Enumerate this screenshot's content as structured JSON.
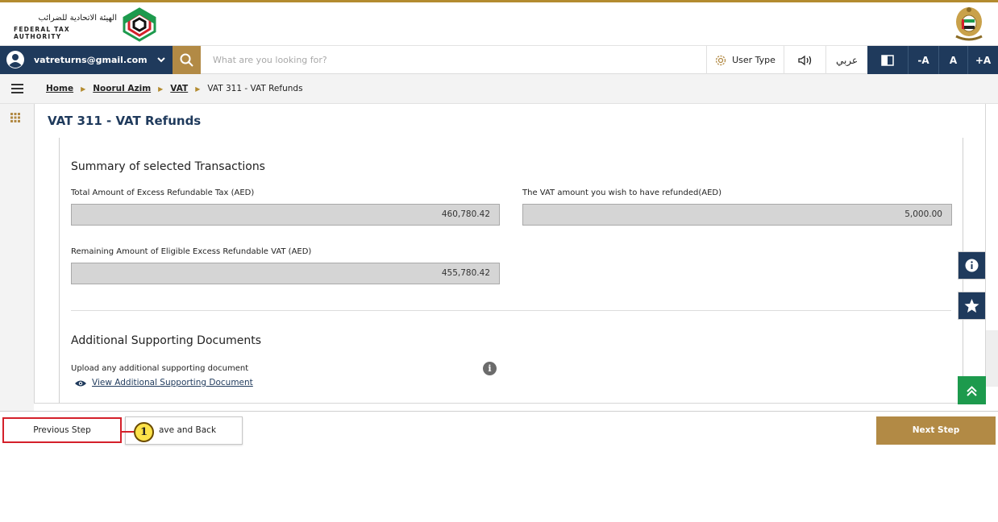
{
  "header": {
    "logo_arabic": "الهيئة الاتحادية للضرائب",
    "logo_english": "FEDERAL TAX AUTHORITY",
    "logo_icon": "fta-logo-icon",
    "emblem_icon": "uae-emblem-icon"
  },
  "toolbar": {
    "user_email": "vatreturns@gmail.com",
    "search_placeholder": "What are you looking for?",
    "user_type_label": "User Type",
    "arabic_label": "عربي",
    "font_decrease": "-A",
    "font_normal": "A",
    "font_increase": "+A"
  },
  "breadcrumb": {
    "items": [
      "Home",
      "Noorul Azim",
      "VAT"
    ],
    "current": "VAT 311 - VAT Refunds"
  },
  "page": {
    "title": "VAT 311 - VAT Refunds"
  },
  "summary": {
    "title": "Summary of selected Transactions",
    "total_label": "Total Amount of Excess Refundable Tax (AED)",
    "total_value": "460,780.42",
    "refund_label": "The VAT amount you wish to have refunded(AED)",
    "refund_value": "5,000.00",
    "remaining_label": "Remaining Amount of Eligible Excess Refundable VAT (AED)",
    "remaining_value": "455,780.42"
  },
  "documents": {
    "title": "Additional Supporting Documents",
    "upload_label": "Upload any additional supporting document",
    "info_glyph": "i",
    "view_link": "View Additional Supporting Document"
  },
  "footer": {
    "previous_label": "Previous Step",
    "save_label": "ave and Back",
    "next_label": "Next Step",
    "marker_number": "1"
  },
  "colors": {
    "brand_navy": "#1f3a5c",
    "brand_gold": "#b28a45",
    "highlight_red": "#d4202a",
    "scroll_green": "#1d9a4d"
  }
}
